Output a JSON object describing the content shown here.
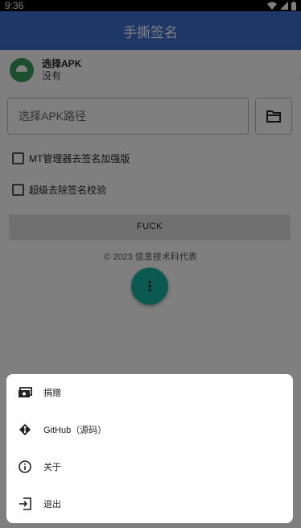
{
  "status_bar": {
    "time": "9:36"
  },
  "app_bar": {
    "title": "手撕签名"
  },
  "apk": {
    "title": "选择APK",
    "subtitle": "没有"
  },
  "path_input": {
    "placeholder": "选择APK路径"
  },
  "options": [
    {
      "label": "MT管理器去签名加强版",
      "checked": false
    },
    {
      "label": "超级去除签名校验",
      "checked": false
    }
  ],
  "main_button": {
    "label": "FUCK"
  },
  "footer": {
    "copyright": "© 2023 信息技术科代表"
  },
  "menu": [
    {
      "icon": "money-icon",
      "label": "捐赠"
    },
    {
      "icon": "git-icon",
      "label": "GitHub（源码）"
    },
    {
      "icon": "info-icon",
      "label": "关于"
    },
    {
      "icon": "exit-icon",
      "label": "退出"
    }
  ],
  "colors": {
    "app_bar": "#3f6fcf",
    "fab": "#14b5a5",
    "scrim": "rgba(0,0,0,0.5)"
  }
}
